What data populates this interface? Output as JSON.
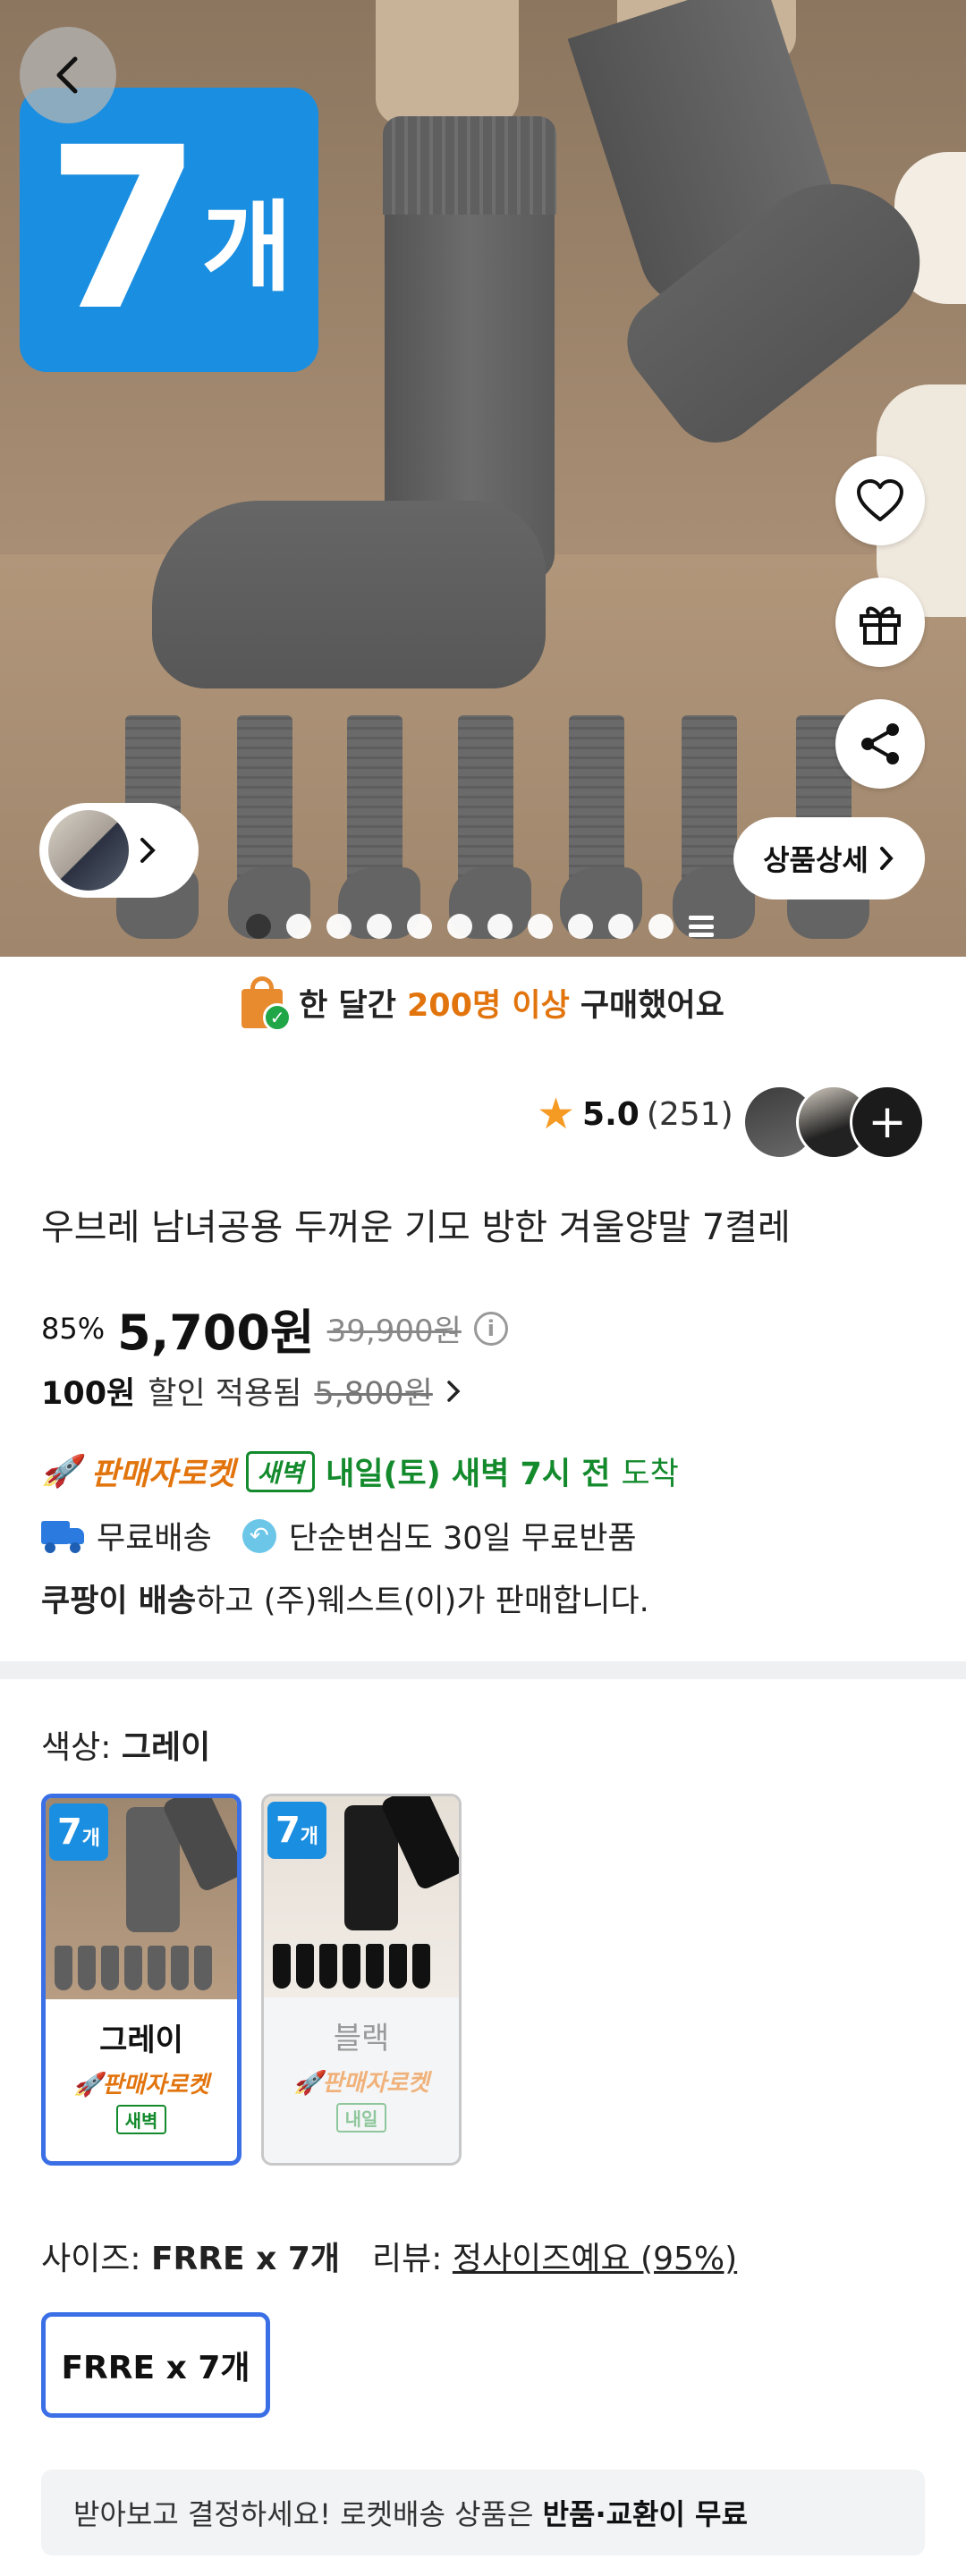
{
  "hero": {
    "badge_number": "7",
    "badge_unit": "개",
    "detail_button": "상품상세",
    "carousel_total_dots": 11,
    "carousel_active_index": 0
  },
  "purchased": {
    "prefix": "한 달간",
    "highlight": "200명 이상",
    "suffix": "구매했어요"
  },
  "rating": {
    "score": "5.0",
    "count": "(251)",
    "more_icon": "+"
  },
  "product": {
    "title": "우브레 남녀공용 두꺼운 기모 방한 겨울양말 7켤레",
    "discount_pct": "85%",
    "price": "5,700원",
    "original_price": "39,900원",
    "extra_discount_amount": "100원",
    "extra_discount_label": "할인 적용됨",
    "extra_discount_struck": "5,800원"
  },
  "delivery": {
    "brand": "판매자로켓",
    "tag": "새벽",
    "arrive_strong": "내일(토) 새벽 7시 전",
    "arrive_light": "도착",
    "free_shipping": "무료배송",
    "free_return": "단순변심도 30일 무료반품",
    "seller_bold": "쿠팡이 배송",
    "seller_rest": "하고 (주)웨스트(이)가 판매합니다."
  },
  "color": {
    "label": "색상:",
    "selected": "그레이",
    "options": [
      {
        "name": "그레이",
        "badge": "7",
        "badge_unit": "개",
        "rocket": "판매자로켓",
        "tag": "새벽"
      },
      {
        "name": "블랙",
        "badge": "7",
        "badge_unit": "개",
        "rocket": "판매자로켓",
        "tag": "내일"
      }
    ]
  },
  "size": {
    "label": "사이즈:",
    "selected": "FRRE x 7개",
    "review_label": "리뷰:",
    "review_value": "정사이즈예요 (95%)",
    "button": "FRRE x 7개"
  },
  "return_banner": {
    "text": "받아보고 결정하세요! 로켓배송 상품은",
    "bold": "반품·교환이 무료"
  },
  "colors": {
    "accent_blue": "#3a6fe6",
    "badge_blue": "#1a8ee0",
    "rocket_orange": "#e2740d",
    "green": "#138a2c",
    "star": "#f59a23"
  }
}
